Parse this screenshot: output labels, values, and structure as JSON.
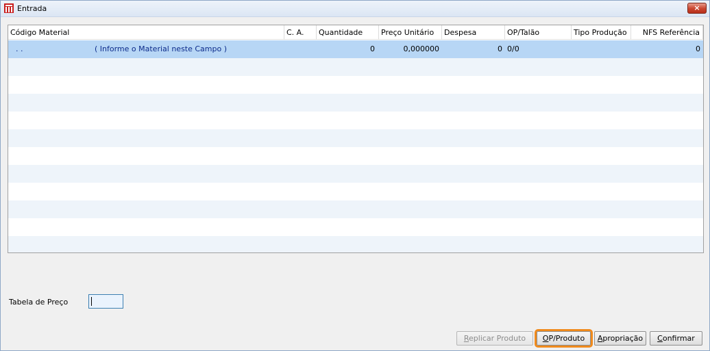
{
  "window": {
    "title": "Entrada",
    "close_glyph": "×"
  },
  "grid": {
    "columns": [
      {
        "label": "Código Material"
      },
      {
        "label": "C. A."
      },
      {
        "label": "Quantidade"
      },
      {
        "label": "Preço Unitário"
      },
      {
        "label": "Despesa"
      },
      {
        "label": "OP/Talão"
      },
      {
        "label": "Tipo Produção"
      },
      {
        "label": "NFS Referência"
      }
    ],
    "rows": [
      {
        "codigo": ".  .",
        "descricao": "( Informe o Material neste Campo )",
        "ca": "",
        "quantidade": "0",
        "preco_unitario": "0,000000",
        "despesa": "0",
        "op_talao": "0/0",
        "tipo_producao": "",
        "nfs_referencia": "0"
      }
    ]
  },
  "form": {
    "tabela_preco_label": "Tabela de Preço",
    "tabela_preco_value": ""
  },
  "buttons": {
    "replicar": {
      "prefix": "",
      "accel": "R",
      "rest": "eplicar Produto"
    },
    "op_produto": {
      "prefix": "",
      "accel": "O",
      "rest": "P/Produto"
    },
    "apropriacao": {
      "prefix": "",
      "accel": "A",
      "rest": "propriação"
    },
    "confirmar": {
      "prefix": "",
      "accel": "C",
      "rest": "onfirmar"
    }
  },
  "icons": {
    "app": "app-logo-icon",
    "close": "close-icon"
  },
  "colors": {
    "selected_row": "#b7d6f5",
    "focus_outline": "#f08a1c",
    "title_bg": "#dbe6f4"
  }
}
